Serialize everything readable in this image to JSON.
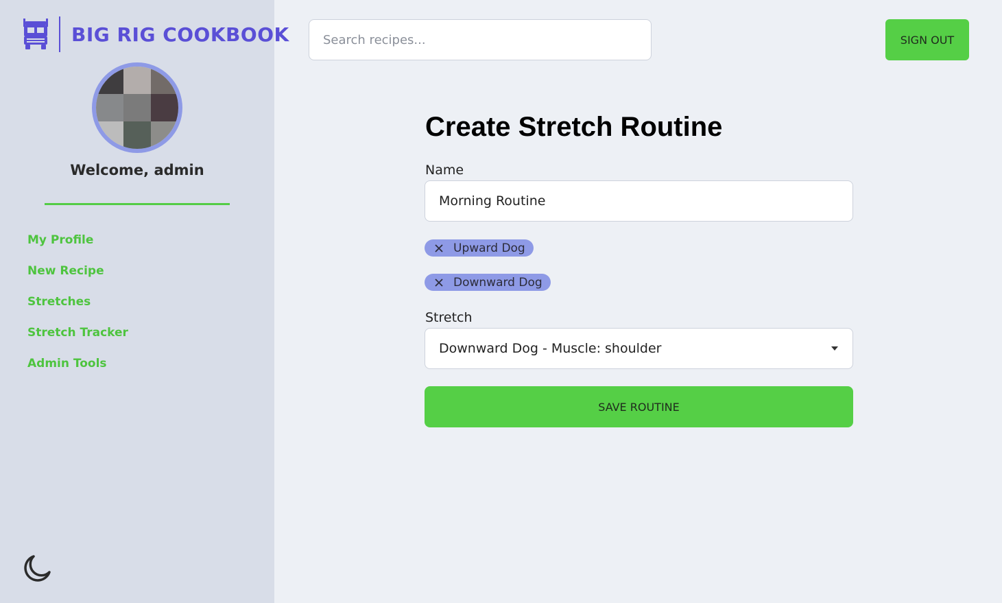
{
  "brand": {
    "name": "BIG RIG COOKBOOK",
    "icon": "truck-icon"
  },
  "sidebar": {
    "welcome": "Welcome, admin",
    "items": [
      {
        "label": "My Profile"
      },
      {
        "label": "New Recipe"
      },
      {
        "label": "Stretches"
      },
      {
        "label": "Stretch Tracker"
      },
      {
        "label": "Admin Tools"
      }
    ],
    "theme_toggle_icon": "moon-icon"
  },
  "header": {
    "search_placeholder": "Search recipes...",
    "search_value": "",
    "signout_label": "SIGN OUT"
  },
  "form": {
    "title": "Create Stretch Routine",
    "name_label": "Name",
    "name_value": "Morning Routine",
    "selected_stretches": [
      {
        "label": "Upward Dog"
      },
      {
        "label": "Downward Dog"
      }
    ],
    "stretch_label": "Stretch",
    "stretch_selected": "Downward Dog - Muscle: shoulder",
    "save_label": "SAVE ROUTINE"
  },
  "colors": {
    "accent_purple": "#5a4fd6",
    "accent_green": "#55cf46",
    "chip_purple": "#8e9ae6",
    "sidebar_bg": "#d8dde8",
    "page_bg": "#edf0f5"
  }
}
